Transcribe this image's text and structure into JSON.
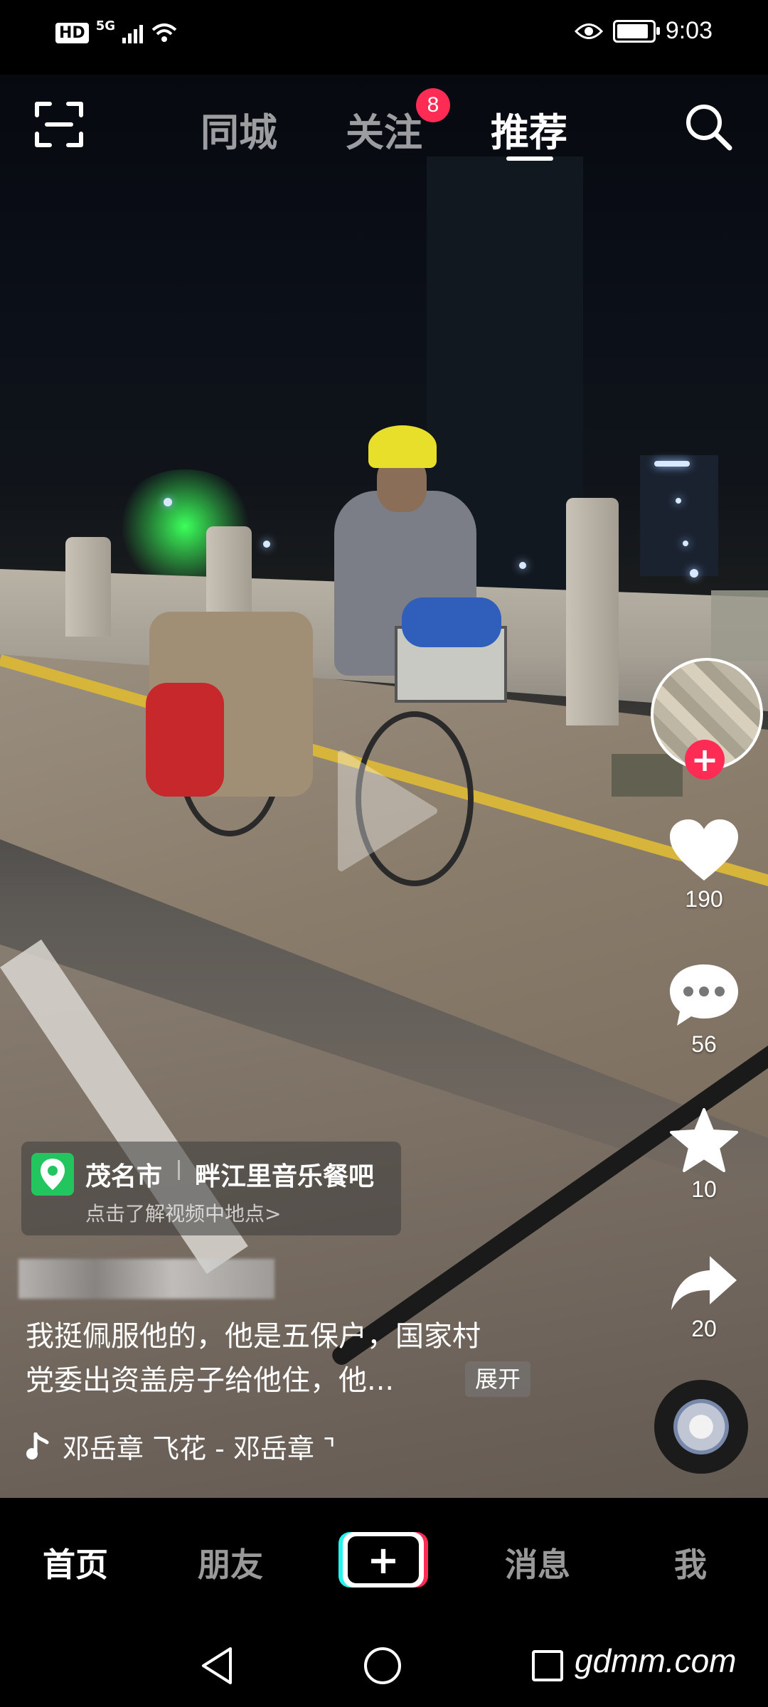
{
  "status_bar": {
    "hd_label": "HD",
    "network_label": "5G",
    "time": "9:03",
    "battery_level": 0.9
  },
  "top_nav": {
    "tabs": [
      {
        "label": "同城",
        "active": false
      },
      {
        "label": "关注",
        "active": false,
        "badge": "8"
      },
      {
        "label": "推荐",
        "active": true
      }
    ]
  },
  "right_rail": {
    "like_count": "190",
    "comment_count": "56",
    "favorite_count": "10",
    "share_count": "20",
    "follow_symbol": "+"
  },
  "location": {
    "city": "茂名市",
    "place": "畔江里音乐餐吧",
    "hint": "点击了解视频中地点>"
  },
  "post": {
    "description_line1": "我挺佩服他的，他是五保户，国家村",
    "description_line2": "党委出资盖房子给他住，他...",
    "expand_label": "展开",
    "music_text": "邓岳章    飞花 - 邓岳章    ⌝"
  },
  "bottom_bar": {
    "items": [
      "首页",
      "朋友",
      "消息",
      "我"
    ],
    "active_index": 0,
    "plus_symbol": "+"
  },
  "system_nav": {
    "watermark": "gdmm.com"
  },
  "colors": {
    "accent": "#fe2c55",
    "cyan": "#25f4ee",
    "location_green": "#22c55e"
  }
}
